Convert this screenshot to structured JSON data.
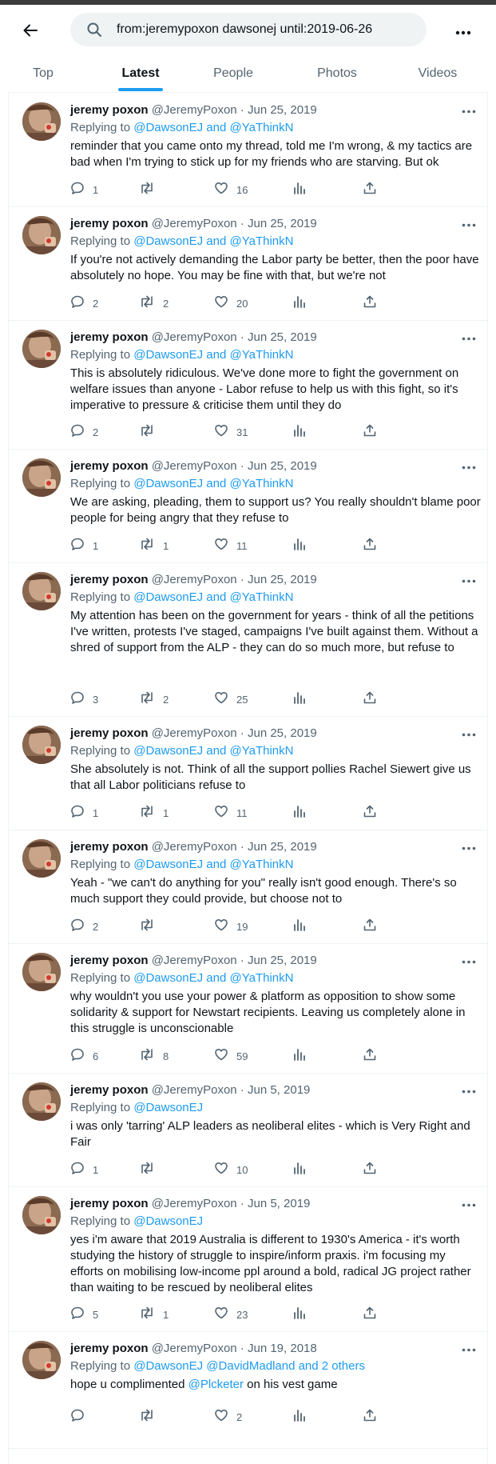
{
  "search": {
    "query": "from:jeremypoxon dawsonej until:2019-06-26"
  },
  "tabs": [
    "Top",
    "Latest",
    "People",
    "Photos",
    "Videos"
  ],
  "active_tab": "Latest",
  "colors": {
    "accent": "#1d9bf0",
    "text": "#0f1419",
    "muted": "#536471",
    "divider": "#eff3f4"
  },
  "tweets": [
    {
      "name": "jeremy poxon",
      "handle": "@JeremyPoxon",
      "sep": " · ",
      "date": "Jun 25, 2019",
      "reply_prefix": "Replying to ",
      "reply_to": "@DawsonEJ and @YaThinkN",
      "text": "reminder that you came onto my thread, told me I'm wrong, & my tactics are bad when I'm trying to stick up for my friends who are starving. But ok",
      "replies": "1",
      "retweets": "",
      "likes": "16"
    },
    {
      "name": "jeremy poxon",
      "handle": "@JeremyPoxon",
      "sep": " · ",
      "date": "Jun 25, 2019",
      "reply_prefix": "Replying to ",
      "reply_to": "@DawsonEJ and @YaThinkN",
      "text": "If you're not actively demanding the Labor party be better, then the poor have absolutely no hope. You may be fine with that, but we're not",
      "replies": "2",
      "retweets": "2",
      "likes": "20"
    },
    {
      "name": "jeremy poxon",
      "handle": "@JeremyPoxon",
      "sep": " · ",
      "date": "Jun 25, 2019",
      "reply_prefix": "Replying to ",
      "reply_to": "@DawsonEJ and @YaThinkN",
      "text": "This is absolutely ridiculous. We've done more to fight the government on welfare issues than anyone - Labor refuse to help us with this fight, so it's imperative to pressure & criticise them until they do",
      "replies": "2",
      "retweets": "",
      "likes": "31"
    },
    {
      "name": "jeremy poxon",
      "handle": "@JeremyPoxon",
      "sep": " · ",
      "date": "Jun 25, 2019",
      "reply_prefix": "Replying to ",
      "reply_to": "@DawsonEJ and @YaThinkN",
      "text": "We are asking, pleading, them to support us? You really shouldn't blame poor people for being angry that they refuse to",
      "replies": "1",
      "retweets": "1",
      "likes": "11"
    },
    {
      "name": "jeremy poxon",
      "handle": "@JeremyPoxon",
      "sep": " · ",
      "date": "Jun 25, 2019",
      "reply_prefix": "Replying to ",
      "reply_to": "@DawsonEJ and @YaThinkN",
      "text": "My attention has been on the government for years - think of all the petitions I've written, protests I've staged, campaigns I've built against them. Without a shred of support from the ALP - they can do so much more, but refuse to",
      "replies": "3",
      "retweets": "2",
      "likes": "25"
    },
    {
      "name": "jeremy poxon",
      "handle": "@JeremyPoxon",
      "sep": " · ",
      "date": "Jun 25, 2019",
      "reply_prefix": "Replying to ",
      "reply_to": "@DawsonEJ and @YaThinkN",
      "text": "She absolutely is not. Think of all the support pollies Rachel Siewert give us that all Labor politicians refuse to",
      "replies": "1",
      "retweets": "1",
      "likes": "11"
    },
    {
      "name": "jeremy poxon",
      "handle": "@JeremyPoxon",
      "sep": " · ",
      "date": "Jun 25, 2019",
      "reply_prefix": "Replying to ",
      "reply_to": "@DawsonEJ and @YaThinkN",
      "text": "Yeah - \"we can't do anything for you\" really isn't good enough. There's so much support they could provide, but choose not to",
      "replies": "2",
      "retweets": "",
      "likes": "19"
    },
    {
      "name": "jeremy poxon",
      "handle": "@JeremyPoxon",
      "sep": " · ",
      "date": "Jun 25, 2019",
      "reply_prefix": "Replying to ",
      "reply_to": "@DawsonEJ and @YaThinkN",
      "text": "why wouldn't you use your power & platform as opposition to show some solidarity & support for Newstart recipients. Leaving us completely alone in this struggle is unconscionable",
      "replies": "6",
      "retweets": "8",
      "likes": "59"
    },
    {
      "name": "jeremy poxon",
      "handle": "@JeremyPoxon",
      "sep": " · ",
      "date": "Jun 5, 2019",
      "reply_prefix": "Replying to ",
      "reply_to": "@DawsonEJ",
      "text": "i was only 'tarring' ALP leaders as neoliberal elites - which is Very Right and Fair",
      "replies": "1",
      "retweets": "",
      "likes": "10"
    },
    {
      "name": "jeremy poxon",
      "handle": "@JeremyPoxon",
      "sep": " · ",
      "date": "Jun 5, 2019",
      "reply_prefix": "Replying to ",
      "reply_to": "@DawsonEJ",
      "text": "yes i'm aware that 2019 Australia is different to 1930's America - it's worth studying the history of struggle to inspire/inform praxis. i'm focusing my efforts on mobilising low-income ppl around a bold, radical JG project rather than waiting to be rescued by neoliberal elites",
      "replies": "5",
      "retweets": "1",
      "likes": "23"
    },
    {
      "name": "jeremy poxon",
      "handle": "@JeremyPoxon",
      "sep": " · ",
      "date": "Jun 19, 2018",
      "reply_prefix": "Replying to ",
      "reply_to": "@DawsonEJ @DavidMadland and 2 others",
      "text": "hope u complimented ",
      "text_link": "@Plcketer",
      "text_after": " on his vest game",
      "replies": "",
      "retweets": "",
      "likes": "2"
    }
  ]
}
